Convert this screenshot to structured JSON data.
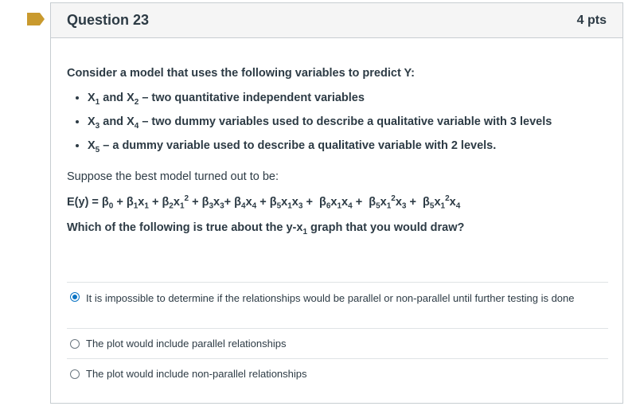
{
  "question": {
    "title": "Question 23",
    "points": "4 pts",
    "intro": "Consider a model that uses the following variables to predict Y:",
    "variables": [
      {
        "v1": "X",
        "s1": "1",
        "and": " and ",
        "v2": "X",
        "s2": "2",
        "desc": " – two quantitative independent variables"
      },
      {
        "v1": "X",
        "s1": "3",
        "and": " and ",
        "v2": "X",
        "s2": "4",
        "desc": " – two dummy variables used to describe a qualitative variable with 3 levels"
      },
      {
        "v1": "X",
        "s1": "5",
        "desc": " – a dummy variable used to describe a qualitative variable with 2 levels."
      }
    ],
    "suppose": "Suppose the best model turned out to be:",
    "equation_lhs": "E(y) = ",
    "which": "Which of the following is true about the y-x",
    "which_sub": "1",
    "which_end": " graph that you would draw?"
  },
  "answers": [
    {
      "text": "It is impossible to determine if the relationships would be parallel or non-parallel until further testing is done",
      "selected": true
    },
    {
      "text": "The plot would include parallel relationships",
      "selected": false
    },
    {
      "text": "The plot would include non-parallel relationships",
      "selected": false
    }
  ],
  "colors": {
    "flag": "#c99a2e",
    "accent": "#0b74c4"
  }
}
